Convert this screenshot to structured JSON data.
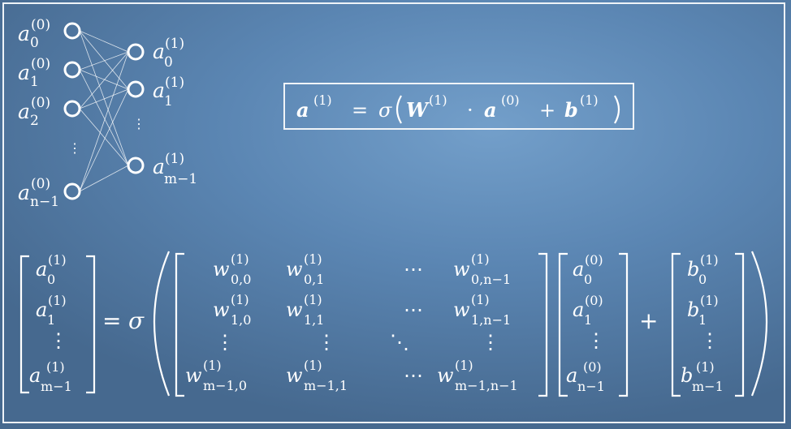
{
  "network": {
    "input_nodes": [
      {
        "var": "a",
        "sup": "(0)",
        "sub": "0"
      },
      {
        "var": "a",
        "sup": "(0)",
        "sub": "1"
      },
      {
        "var": "a",
        "sup": "(0)",
        "sub": "2"
      },
      {
        "var": "a",
        "sup": "(0)",
        "sub": "n−1"
      }
    ],
    "output_nodes": [
      {
        "var": "a",
        "sup": "(1)",
        "sub": "0"
      },
      {
        "var": "a",
        "sup": "(1)",
        "sub": "1"
      },
      {
        "var": "a",
        "sup": "(1)",
        "sub": "m−1"
      }
    ],
    "ellipsis": "⋮"
  },
  "compact_equation": {
    "lhs_var": "a",
    "lhs_sup": "(1)",
    "equals": "=",
    "sigma": "σ",
    "W_var": "W",
    "W_sup": "(1)",
    "dot": "·",
    "a_var": "a",
    "a_sup": "(0)",
    "plus": "+",
    "b_var": "b",
    "b_sup": "(1)"
  },
  "matrix_equation": {
    "lhs": {
      "var": "a",
      "sup": "(1)",
      "subs": [
        "0",
        "1",
        "m−1"
      ]
    },
    "equals": "=",
    "sigma": "σ",
    "weights": {
      "var": "w",
      "sup": "(1)",
      "rows": [
        [
          "0,0",
          "0,1",
          "⋯",
          "0,n−1"
        ],
        [
          "1,0",
          "1,1",
          "⋯",
          "1,n−1"
        ],
        [
          "⋮",
          "⋮",
          "⋱",
          "⋮"
        ],
        [
          "m−1,0",
          "m−1,1",
          "⋯",
          "m−1,n−1"
        ]
      ]
    },
    "activations": {
      "var": "a",
      "sup": "(0)",
      "subs": [
        "0",
        "1",
        "n−1"
      ]
    },
    "plus": "+",
    "bias": {
      "var": "b",
      "sup": "(1)",
      "subs": [
        "0",
        "1",
        "m−1"
      ]
    },
    "vdots": "⋮"
  }
}
